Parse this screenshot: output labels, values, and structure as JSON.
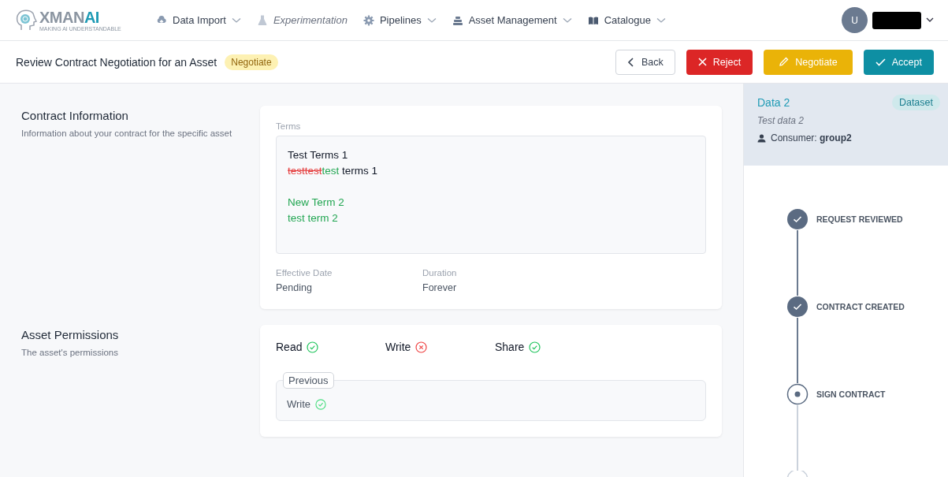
{
  "logo": {
    "name_left": "XMAN",
    "name_right": "AI",
    "tagline": "MAKING AI UNDERSTANDABLE"
  },
  "nav": [
    {
      "label": "Data Import",
      "dropdown": true,
      "disabled": false
    },
    {
      "label": "Experimentation",
      "dropdown": false,
      "disabled": true
    },
    {
      "label": "Pipelines",
      "dropdown": true,
      "disabled": false
    },
    {
      "label": "Asset Management",
      "dropdown": true,
      "disabled": false
    },
    {
      "label": "Catalogue",
      "dropdown": true,
      "disabled": false
    }
  ],
  "user": {
    "initial": "U",
    "name_redacted": true
  },
  "header": {
    "title": "Review Contract Negotiation for an Asset",
    "status": "Negotiate"
  },
  "actions": [
    {
      "kind": "back",
      "label": "Back"
    },
    {
      "kind": "reject",
      "label": "Reject"
    },
    {
      "kind": "negotiate",
      "label": "Negotiate"
    },
    {
      "kind": "accept",
      "label": "Accept"
    }
  ],
  "contract": {
    "title": "Contract Information",
    "description": "Information about your contract for the specific asset",
    "terms_label": "Terms",
    "terms_paragraphs": [
      [
        [
          {
            "kind": "same",
            "text": "Test Terms 1"
          }
        ],
        [
          {
            "kind": "removed",
            "text": "testtest"
          },
          {
            "kind": "added",
            "text": "test"
          },
          {
            "kind": "same",
            "text": " terms 1"
          }
        ]
      ],
      [
        [
          {
            "kind": "added",
            "text": "New Term 2"
          }
        ],
        [
          {
            "kind": "added",
            "text": "test term 2"
          }
        ]
      ]
    ],
    "fields": [
      {
        "label": "Effective Date",
        "value": "Pending"
      },
      {
        "label": "Duration",
        "value": "Forever"
      }
    ]
  },
  "permissions": {
    "title": "Asset Permissions",
    "description": "The asset's permissions",
    "current": [
      {
        "label": "Read",
        "granted": true
      },
      {
        "label": "Write",
        "granted": false
      },
      {
        "label": "Share",
        "granted": true
      }
    ],
    "previous_label": "Previous",
    "previous": [
      {
        "label": "Write",
        "granted": true
      }
    ]
  },
  "asset": {
    "name": "Data 2",
    "type": "Dataset",
    "description": "Test data 2",
    "consumer_label": "Consumer:",
    "consumer": "group2"
  },
  "steps": [
    {
      "label": "REQUEST REVIEWED",
      "done": true
    },
    {
      "label": "CONTRACT CREATED",
      "done": true
    },
    {
      "label": "SIGN CONTRACT",
      "done": false
    }
  ]
}
